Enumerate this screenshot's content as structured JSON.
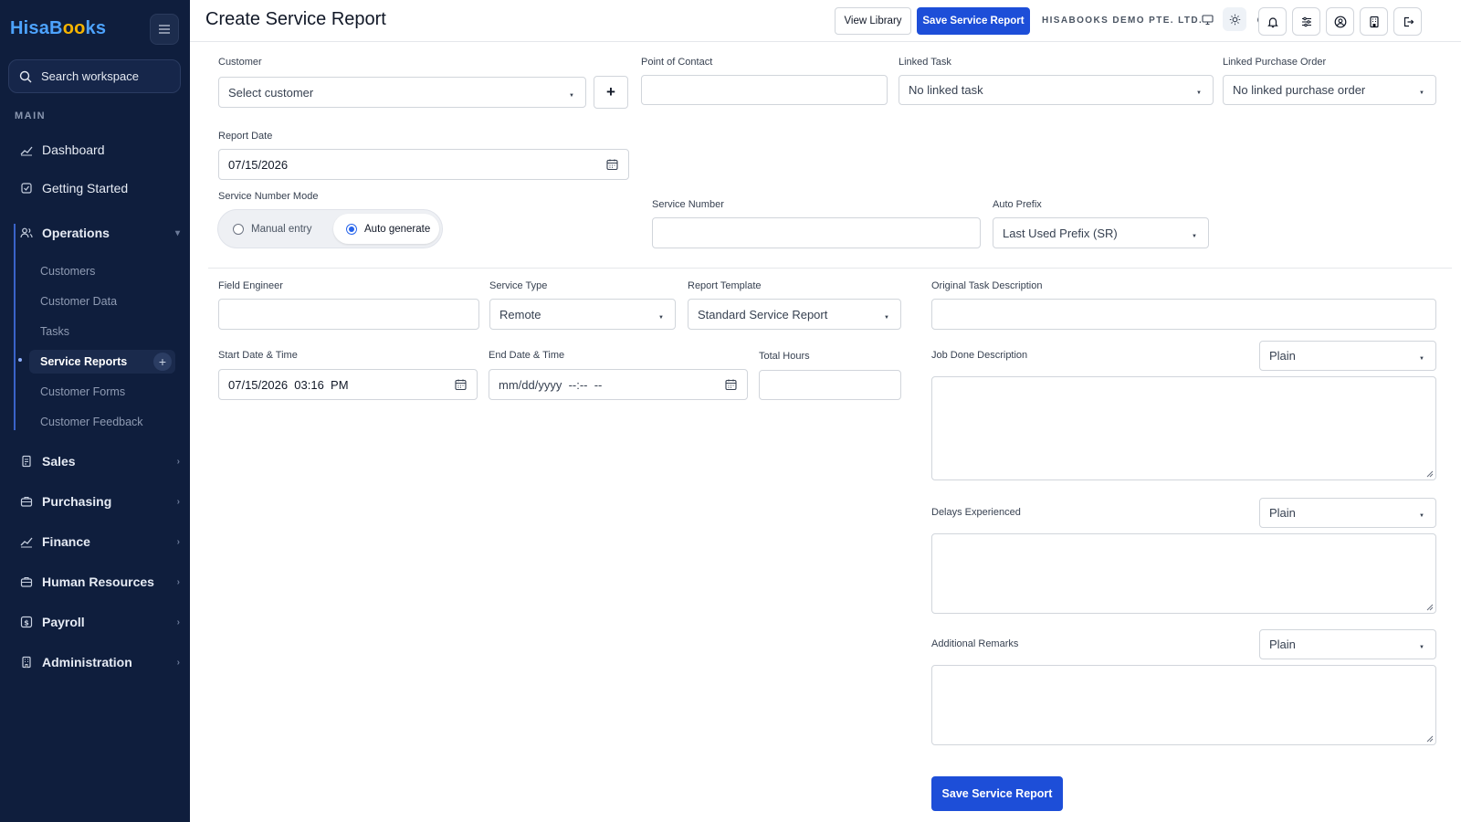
{
  "app": {
    "logo_part1": "Hisa",
    "logo_part2": "Books"
  },
  "sidebar": {
    "search_label": "Search workspace",
    "section_main": "MAIN",
    "dashboard": "Dashboard",
    "getting_started": "Getting Started",
    "operations": "Operations",
    "sub_items": [
      "Customers",
      "Customer Data",
      "Tasks",
      "Service Reports",
      "Customer Forms",
      "Customer Feedback"
    ],
    "sales": "Sales",
    "purchasing": "Purchasing",
    "finance": "Finance",
    "human_resources": "Human Resources",
    "payroll": "Payroll",
    "administration": "Administration"
  },
  "header": {
    "title": "Create Service Report",
    "view_library": "View Library",
    "save": "Save Service Report",
    "company": "HISABOOKS DEMO PTE. LTD."
  },
  "form": {
    "customer_label": "Customer",
    "customer_value": "Select customer",
    "add_customer": "+",
    "poc_label": "Point of Contact",
    "poc_value": "",
    "linked_task_label": "Linked Task",
    "linked_task_value": "No linked task",
    "linked_po_label": "Linked Purchase Order",
    "linked_po_value": "No linked purchase order",
    "report_date_label": "Report Date",
    "report_date_value": "07/15/2026",
    "service_mode_label": "Service Number Mode",
    "mode_manual": "Manual entry",
    "mode_auto": "Auto generate",
    "service_number_label": "Service Number",
    "auto_prefix_label": "Auto Prefix",
    "auto_prefix_value": "Last Used Prefix (SR)",
    "field_engineer_label": "Field Engineer",
    "service_type_label": "Service Type",
    "service_type_value": "Remote",
    "report_template_label": "Report Template",
    "report_template_value": "Standard Service Report",
    "original_task_label": "Original Task Description",
    "start_label": "Start Date & Time",
    "start_value": "07/15/2026  03:16  PM",
    "end_label": "End Date & Time",
    "end_value": "mm/dd/yyyy  --:--  --",
    "total_hours_label": "Total Hours",
    "job_done_label": "Job Done Description",
    "delays_label": "Delays Experienced",
    "remarks_label": "Additional Remarks",
    "format_plain": "Plain",
    "submit": "Save Service Report"
  },
  "colors": {
    "sidebar_bg": "#0f1e3d",
    "primary": "#1d4ed8",
    "logo_blue": "#4da3ff",
    "logo_gold": "#f5b400"
  }
}
